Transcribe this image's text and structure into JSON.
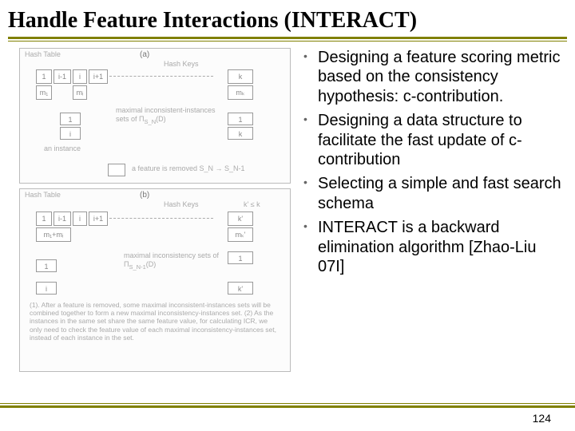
{
  "title": "Handle Feature Interactions (INTERACT)",
  "bullets": [
    "Designing a feature scoring metric based on the consistency hypothesis: c-contribution.",
    "Designing a data structure to facilitate the fast update of c-contribution",
    "Selecting a simple and fast search schema",
    "INTERACT is a backward elimination algorithm [Zhao-Liu 07I]"
  ],
  "page_number": "124",
  "fig_a": {
    "label": "(a)",
    "hash_table": "Hash Table",
    "hash_keys": "Hash Keys",
    "cells_top": [
      "1",
      "i-1",
      "i",
      "i+1",
      "k"
    ],
    "cells_m": [
      "m₁",
      "mᵢ",
      "mₖ"
    ],
    "an_instance": "an instance",
    "maximal": "maximal inconsistent-instances sets of  Π",
    "sub": "S_N",
    "tail": "(D)",
    "removed": "a feature is removed S_N → S_N-1"
  },
  "fig_b": {
    "label": "(b)",
    "hash_table": "Hash Table",
    "hash_keys": "Hash Keys",
    "k_le": "k' ≤ k",
    "cells_top": [
      "1",
      "i-1",
      "i",
      "i+1",
      "k'"
    ],
    "cells_m": [
      "m₁+mᵢ",
      "mₖ'"
    ],
    "left_box": [
      "1",
      "i"
    ],
    "maximal": "maximal inconsistency sets of  Π",
    "sub": "S_N-1",
    "tail": "(D)",
    "note1": "(1). After a feature is removed, some maximal inconsistent-instances sets will be combined together to form a new maximal inconsistency-instances set. (2) As the instances in the same set share the same feature value, for calculating ICR, we only need to check the feature value of each maximal inconsistency-instances set, instead of each instance in the set."
  }
}
